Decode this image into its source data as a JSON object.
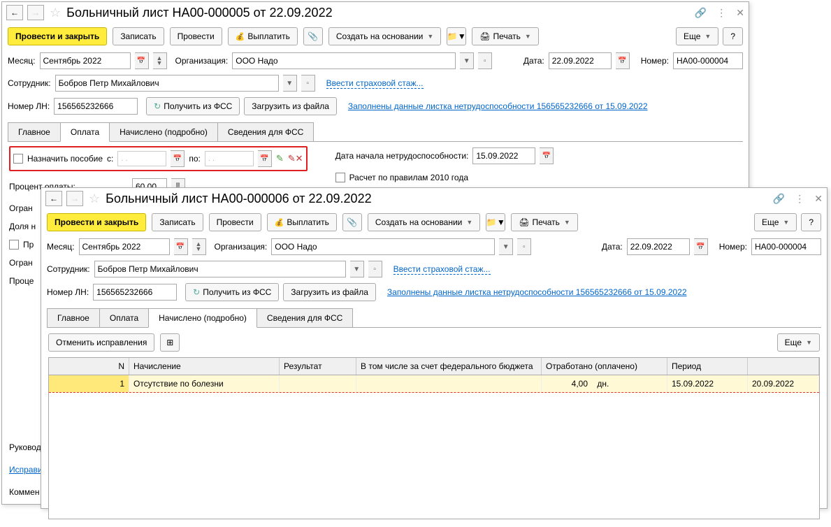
{
  "window1": {
    "title": "Больничный лист НА00-000005 от 22.09.2022",
    "toolbar": {
      "post_close": "Провести и закрыть",
      "save": "Записать",
      "post": "Провести",
      "pay": "Выплатить",
      "create_based": "Создать на основании",
      "print": "Печать",
      "more": "Еще",
      "help": "?"
    },
    "fields": {
      "month_label": "Месяц:",
      "month": "Сентябрь 2022",
      "org_label": "Организация:",
      "org": "ООО Надо",
      "date_label": "Дата:",
      "date": "22.09.2022",
      "number_label": "Номер:",
      "number": "НА00-000004",
      "employee_label": "Сотрудник:",
      "employee": "Бобров Петр Михайлович",
      "ins_link": "Ввести страховой стаж...",
      "ln_label": "Номер ЛН:",
      "ln": "156565232666",
      "get_fss": "Получить из ФСС",
      "load_file": "Загрузить из файла",
      "filled_link": "Заполнены данные листка нетрудоспособности 156565232666 от 15.09.2022"
    },
    "tabs": [
      "Главное",
      "Оплата",
      "Начислено (подробно)",
      "Сведения для ФСС"
    ],
    "active_tab": 1,
    "payment": {
      "assign_label": "Назначить пособие",
      "from_label": "с:",
      "to_label": "по:",
      "date_placeholder": ".  .",
      "start_label": "Дата начала нетрудоспособности:",
      "start_date": "15.09.2022",
      "percent_label": "Процент оплаты:",
      "percent": "60,00",
      "calc2010": "Расчет по правилам 2010 года",
      "limit_label": "Огран",
      "share_label": "Доля н",
      "pr_label": "Пр",
      "limit_label2": "Огран",
      "proc_label": "Проце"
    },
    "footer": {
      "manager": "Руковод",
      "correct": "Исправи",
      "comment": "Коммен"
    }
  },
  "window2": {
    "title": "Больничный лист НА00-000006 от 22.09.2022",
    "toolbar": {
      "post_close": "Провести и закрыть",
      "save": "Записать",
      "post": "Провести",
      "pay": "Выплатить",
      "create_based": "Создать на основании",
      "print": "Печать",
      "more": "Еще",
      "help": "?"
    },
    "fields": {
      "month_label": "Месяц:",
      "month": "Сентябрь 2022",
      "org_label": "Организация:",
      "org": "ООО Надо",
      "date_label": "Дата:",
      "date": "22.09.2022",
      "number_label": "Номер:",
      "number": "НА00-000004",
      "employee_label": "Сотрудник:",
      "employee": "Бобров Петр Михайлович",
      "ins_link": "Ввести страховой стаж...",
      "ln_label": "Номер ЛН:",
      "ln": "156565232666",
      "get_fss": "Получить из ФСС",
      "load_file": "Загрузить из файла",
      "filled_link": "Заполнены данные листка нетрудоспособности 156565232666 от 15.09.2022"
    },
    "tabs": [
      "Главное",
      "Оплата",
      "Начислено (подробно)",
      "Сведения для ФСС"
    ],
    "active_tab": 2,
    "accrued": {
      "cancel_corrections": "Отменить исправления",
      "more": "Еще",
      "columns": {
        "n": "N",
        "accrual": "Начисление",
        "result": "Результат",
        "federal": "В том числе за счет федерального бюджета",
        "worked": "Отработано (оплачено)",
        "period": "Период"
      },
      "rows": [
        {
          "n": "1",
          "accrual": "Отсутствие по болезни",
          "result": "",
          "federal": "",
          "worked_val": "4,00",
          "worked_unit": "дн.",
          "period_from": "15.09.2022",
          "period_to": "20.09.2022"
        }
      ]
    }
  }
}
